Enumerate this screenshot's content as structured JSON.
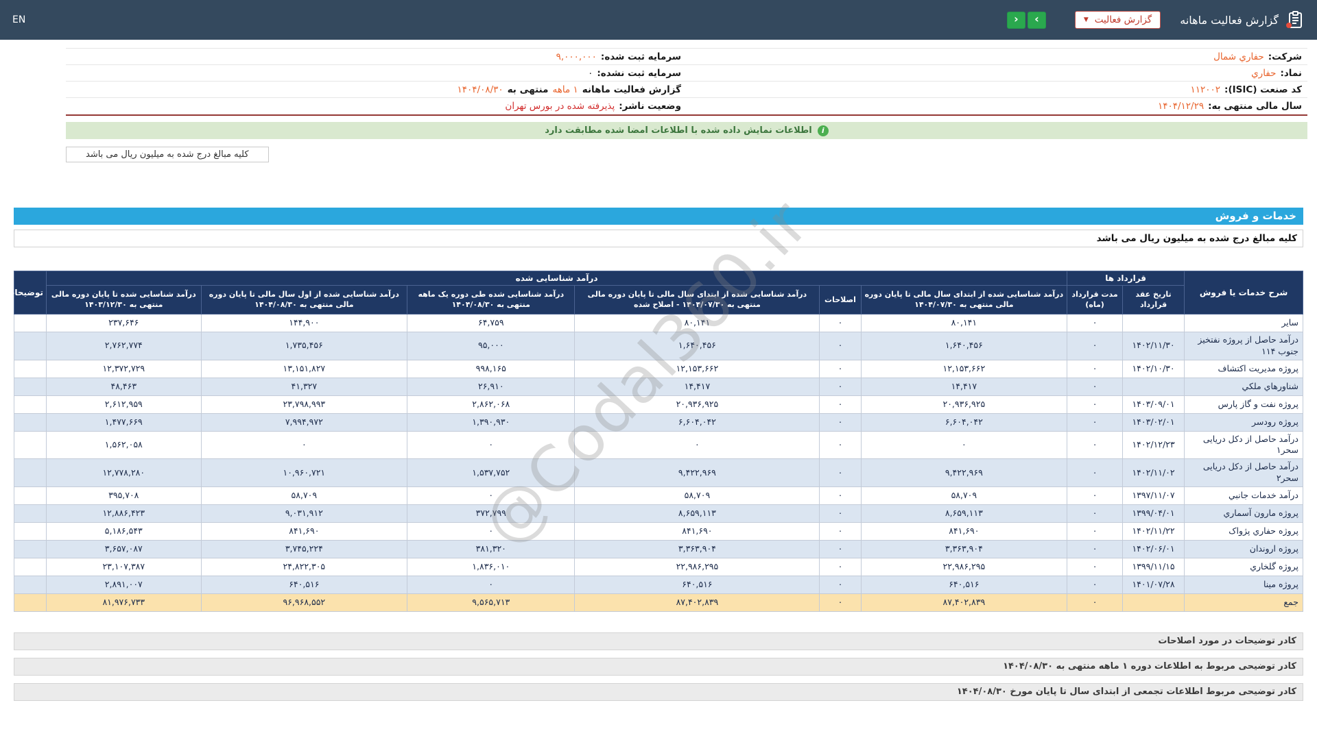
{
  "topbar": {
    "title": "گزارش فعالیت ماهانه",
    "report_dropdown": "گزارش فعالیت",
    "lang": "EN"
  },
  "icons": {
    "chevron_down": "▼",
    "nav_right": "›",
    "nav_left": "‹",
    "info": "i"
  },
  "company_info": {
    "right": [
      {
        "label": "شرکت:",
        "value": "حفاري شمال"
      },
      {
        "label": "نماد:",
        "value": "حفاري"
      },
      {
        "label": "کد صنعت (ISIC):",
        "value": "۱۱۲۰۰۲"
      },
      {
        "label": "سال مالی منتهی به:",
        "value": "۱۴۰۴/۱۲/۲۹"
      }
    ],
    "left": [
      {
        "label": "سرمایه ثبت شده:",
        "value": "۹,۰۰۰,۰۰۰"
      },
      {
        "label": "سرمایه ثبت نشده:",
        "value": "۰"
      },
      {
        "label": "گزارش فعالیت ماهانه",
        "highlight": "۱ ماهه",
        "mid": "منتهی به",
        "value": "۱۴۰۴/۰۸/۳۰"
      },
      {
        "label": "وضعیت ناشر:",
        "value": "پذیرفته شده در بورس تهران"
      }
    ]
  },
  "signature_notice": "اطلاعات نمایش داده شده با اطلاعات امضا شده مطابقت دارد",
  "units_tab": "کلیه مبالغ درج شده به میلیون ریال می باشد",
  "section": {
    "title": "خدمات و فروش",
    "units_note": "کلیه مبالغ درج شده به میلیون ریال می باشد"
  },
  "table": {
    "groups": {
      "description": "شرح خدمات یا فروش",
      "contracts": "قرارداد ها",
      "revenue": "درآمد شناسایی شده",
      "notes": "توضیحات"
    },
    "headers": {
      "contract_date": "تاریخ عقد قرارداد",
      "duration": "مدت قرارداد (ماه)",
      "rev_before": "درآمد شناسایی شده از ابتدای سال مالی تا پایان دوره مالی منتهی به ۱۴۰۴/۰۷/۳۰",
      "corrections": "اصلاحات",
      "rev_corrected": "درآمد شناسایی شده از ابتدای سال مالی تا پایان دوره مالی منتهی به ۱۴۰۴/۰۷/۳۰ - اصلاح شده",
      "rev_month": "درآمد شناسایی شده طی دوره یک ماهه منتهی به ۱۴۰۴/۰۸/۳۰",
      "rev_total": "درآمد شناسایی شده از اول سال مالی تا پایان دوره مالی منتهی به ۱۴۰۴/۰۸/۳۰",
      "rev_prev": "درآمد شناسایی شده تا پایان دوره مالی منتهی به ۱۴۰۳/۱۲/۳۰"
    },
    "rows": [
      {
        "name": "سایر",
        "contract_date": "",
        "duration": "۰",
        "rev_before": "۸۰,۱۴۱",
        "corrections": "۰",
        "rev_corrected": "۸۰,۱۴۱",
        "rev_month": "۶۴,۷۵۹",
        "rev_total": "۱۴۴,۹۰۰",
        "rev_prev": "۲۳۷,۶۴۶",
        "notes": ""
      },
      {
        "name": "درآمد حاصل از پروژه نفتخیز جنوب ۱۱۴",
        "contract_date": "۱۴۰۲/۱۱/۳۰",
        "duration": "۰",
        "rev_before": "۱,۶۴۰,۴۵۶",
        "corrections": "۰",
        "rev_corrected": "۱,۶۴۰,۴۵۶",
        "rev_month": "۹۵,۰۰۰",
        "rev_total": "۱,۷۳۵,۴۵۶",
        "rev_prev": "۲,۷۶۲,۷۷۴",
        "notes": ""
      },
      {
        "name": "پروژه مدیریت اکتشاف",
        "contract_date": "۱۴۰۲/۱۰/۳۰",
        "duration": "۰",
        "rev_before": "۱۲,۱۵۳,۶۶۲",
        "corrections": "۰",
        "rev_corrected": "۱۲,۱۵۳,۶۶۲",
        "rev_month": "۹۹۸,۱۶۵",
        "rev_total": "۱۳,۱۵۱,۸۲۷",
        "rev_prev": "۱۲,۳۷۲,۷۲۹",
        "notes": ""
      },
      {
        "name": "شناورهاي ملكي",
        "contract_date": "",
        "duration": "۰",
        "rev_before": "۱۴,۴۱۷",
        "corrections": "۰",
        "rev_corrected": "۱۴,۴۱۷",
        "rev_month": "۲۶,۹۱۰",
        "rev_total": "۴۱,۳۲۷",
        "rev_prev": "۴۸,۴۶۳",
        "notes": ""
      },
      {
        "name": "پروژه نفت و گاز پارس",
        "contract_date": "۱۴۰۳/۰۹/۰۱",
        "duration": "۰",
        "rev_before": "۲۰,۹۳۶,۹۲۵",
        "corrections": "۰",
        "rev_corrected": "۲۰,۹۳۶,۹۲۵",
        "rev_month": "۲,۸۶۲,۰۶۸",
        "rev_total": "۲۳,۷۹۸,۹۹۳",
        "rev_prev": "۲,۶۱۲,۹۵۹",
        "notes": ""
      },
      {
        "name": "پروژه رودسر",
        "contract_date": "۱۴۰۳/۰۲/۰۱",
        "duration": "۰",
        "rev_before": "۶,۶۰۴,۰۴۲",
        "corrections": "۰",
        "rev_corrected": "۶,۶۰۴,۰۴۲",
        "rev_month": "۱,۳۹۰,۹۳۰",
        "rev_total": "۷,۹۹۴,۹۷۲",
        "rev_prev": "۱,۴۷۷,۶۶۹",
        "notes": ""
      },
      {
        "name": "درآمد حاصل از دکل دریایی سحر۱",
        "contract_date": "۱۴۰۲/۱۲/۲۳",
        "duration": "۰",
        "rev_before": "۰",
        "corrections": "۰",
        "rev_corrected": "۰",
        "rev_month": "۰",
        "rev_total": "۰",
        "rev_prev": "۱,۵۶۲,۰۵۸",
        "notes": ""
      },
      {
        "name": "درآمد حاصل از دکل دریایی سحر۲",
        "contract_date": "۱۴۰۲/۱۱/۰۲",
        "duration": "۰",
        "rev_before": "۹,۴۲۲,۹۶۹",
        "corrections": "۰",
        "rev_corrected": "۹,۴۲۲,۹۶۹",
        "rev_month": "۱,۵۳۷,۷۵۲",
        "rev_total": "۱۰,۹۶۰,۷۲۱",
        "rev_prev": "۱۲,۷۷۸,۲۸۰",
        "notes": ""
      },
      {
        "name": "درآمد خدمات جانبي",
        "contract_date": "۱۳۹۷/۱۱/۰۷",
        "duration": "۰",
        "rev_before": "۵۸,۷۰۹",
        "corrections": "۰",
        "rev_corrected": "۵۸,۷۰۹",
        "rev_month": "۰",
        "rev_total": "۵۸,۷۰۹",
        "rev_prev": "۳۹۵,۷۰۸",
        "notes": ""
      },
      {
        "name": "پروژه مارون آسماري",
        "contract_date": "۱۳۹۹/۰۴/۰۱",
        "duration": "۰",
        "rev_before": "۸,۶۵۹,۱۱۳",
        "corrections": "۰",
        "rev_corrected": "۸,۶۵۹,۱۱۳",
        "rev_month": "۳۷۲,۷۹۹",
        "rev_total": "۹,۰۳۱,۹۱۲",
        "rev_prev": "۱۲,۸۸۶,۴۲۳",
        "notes": ""
      },
      {
        "name": "پروژه حفاري پژواک",
        "contract_date": "۱۴۰۲/۱۱/۲۲",
        "duration": "۰",
        "rev_before": "۸۴۱,۶۹۰",
        "corrections": "۰",
        "rev_corrected": "۸۴۱,۶۹۰",
        "rev_month": "۰",
        "rev_total": "۸۴۱,۶۹۰",
        "rev_prev": "۵,۱۸۶,۵۴۳",
        "notes": ""
      },
      {
        "name": "پروژه اروندان",
        "contract_date": "۱۴۰۲/۰۶/۰۱",
        "duration": "۰",
        "rev_before": "۳,۳۶۳,۹۰۴",
        "corrections": "۰",
        "rev_corrected": "۳,۳۶۳,۹۰۴",
        "rev_month": "۳۸۱,۳۲۰",
        "rev_total": "۳,۷۴۵,۲۲۴",
        "rev_prev": "۳,۶۵۷,۰۸۷",
        "notes": ""
      },
      {
        "name": "پروژه گلخاري",
        "contract_date": "۱۳۹۹/۱۱/۱۵",
        "duration": "۰",
        "rev_before": "۲۲,۹۸۶,۲۹۵",
        "corrections": "۰",
        "rev_corrected": "۲۲,۹۸۶,۲۹۵",
        "rev_month": "۱,۸۳۶,۰۱۰",
        "rev_total": "۲۴,۸۲۲,۳۰۵",
        "rev_prev": "۲۳,۱۰۷,۳۸۷",
        "notes": ""
      },
      {
        "name": "پروژه مینا",
        "contract_date": "۱۴۰۱/۰۷/۲۸",
        "duration": "۰",
        "rev_before": "۶۴۰,۵۱۶",
        "corrections": "۰",
        "rev_corrected": "۶۴۰,۵۱۶",
        "rev_month": "۰",
        "rev_total": "۶۴۰,۵۱۶",
        "rev_prev": "۲,۸۹۱,۰۰۷",
        "notes": ""
      },
      {
        "name": "جمع",
        "is_total": true,
        "contract_date": "",
        "duration": "۰",
        "rev_before": "۸۷,۴۰۲,۸۳۹",
        "corrections": "۰",
        "rev_corrected": "۸۷,۴۰۲,۸۳۹",
        "rev_month": "۹,۵۶۵,۷۱۳",
        "rev_total": "۹۶,۹۶۸,۵۵۲",
        "rev_prev": "۸۱,۹۷۶,۷۳۳",
        "notes": ""
      }
    ]
  },
  "footers": [
    "کادر توضیحات در مورد اصلاحات",
    "کادر توضیحی مربوط به اطلاعات دوره ۱ ماهه منتهی به ۱۴۰۴/۰۸/۳۰",
    "کادر توضیحی مربوط اطلاعات تجمعی از ابتدای سال تا پایان مورخ ۱۴۰۴/۰۸/۳۰"
  ],
  "watermark": "@Codal360.ir",
  "colors": {
    "topbar_bg": "#34495e",
    "accent_orange": "#e8632c",
    "status_red": "#d22d2d",
    "table_header_bg": "#1f3864",
    "zebra_row_bg": "#dbe5f1",
    "total_row_bg": "#fbe2ad",
    "section_bar_bg": "#2ba7dd",
    "notice_bg": "#d9e9cf",
    "notice_text": "#3c763d",
    "nav_button_green": "#2aa84e",
    "divider_maroon": "#943634"
  }
}
